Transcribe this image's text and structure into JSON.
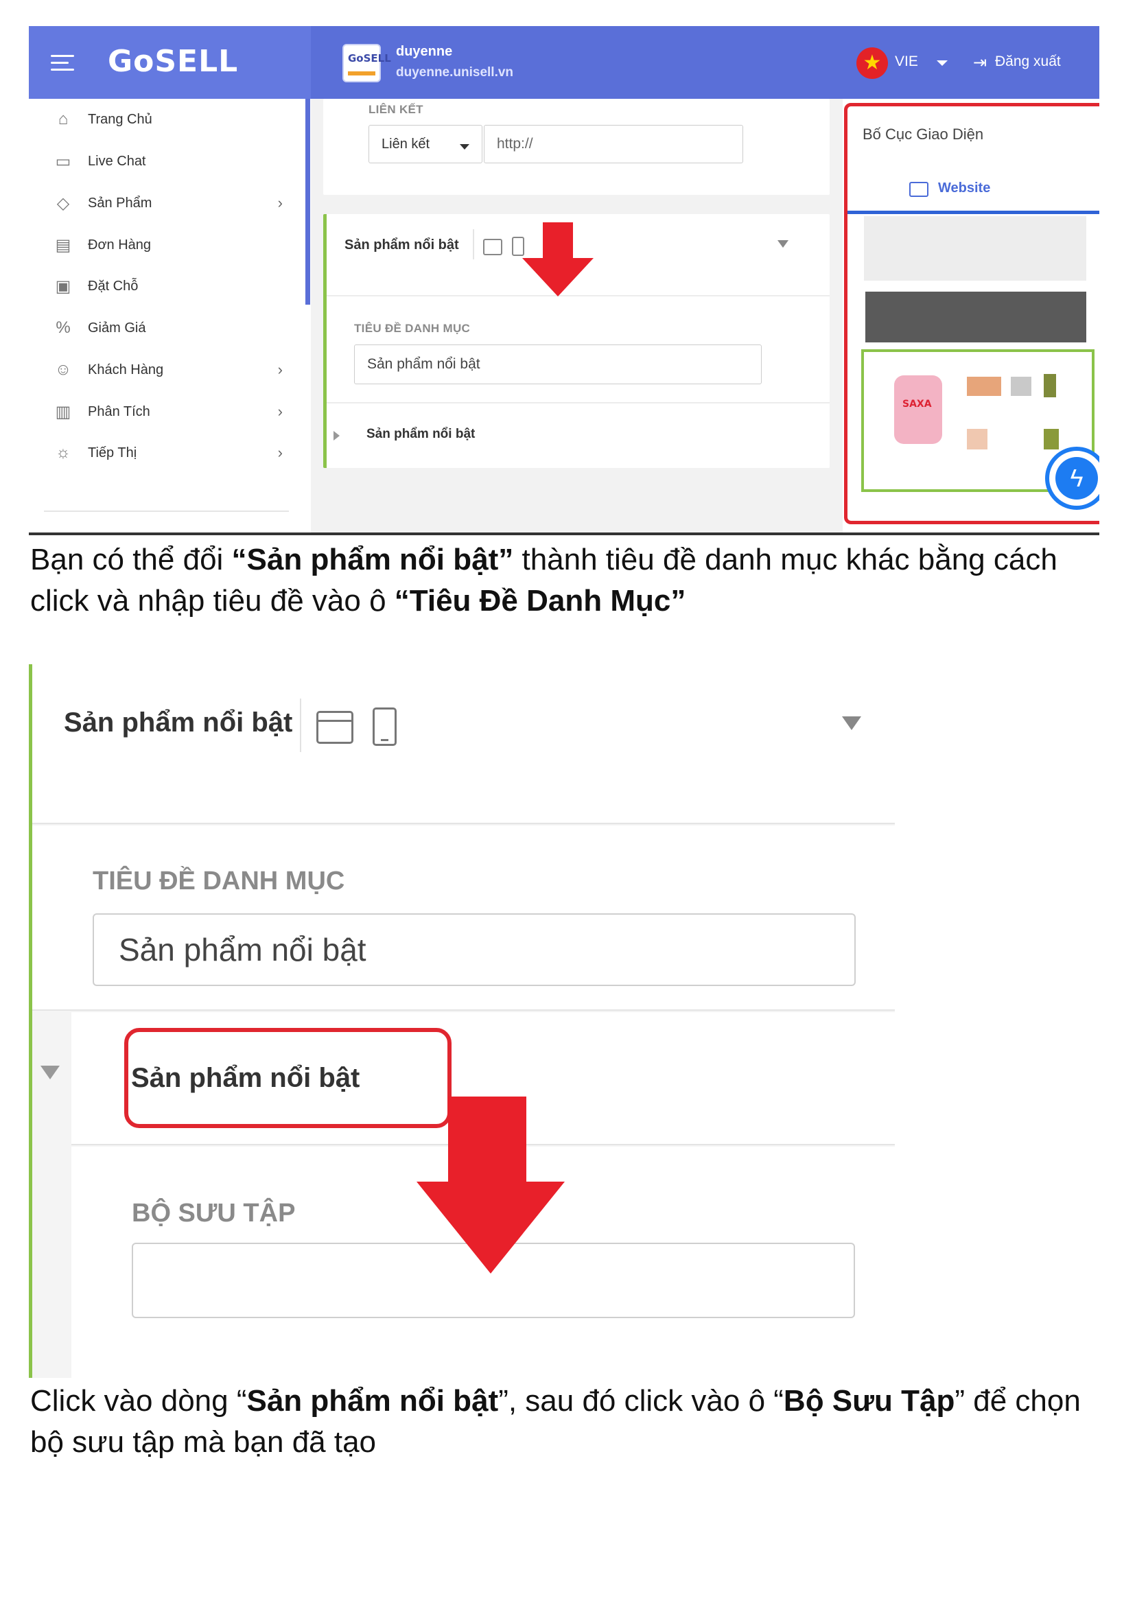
{
  "app": {
    "logo_text": "GoSELL",
    "shop_name": "duyenne",
    "shop_url": "duyenne.unisell.vn",
    "shop_logo_text": "GoSELL",
    "language": "VIE",
    "logout_label": "Đăng xuất",
    "accent_color": "#5a6fd8"
  },
  "sidebar": {
    "items": [
      {
        "label": "Trang Chủ",
        "icon": "home-icon",
        "glyph": "⌂",
        "has_submenu": false
      },
      {
        "label": "Live Chat",
        "icon": "chat-icon",
        "glyph": "▭",
        "has_submenu": false
      },
      {
        "label": "Sản Phẩm",
        "icon": "tag-icon",
        "glyph": "◇",
        "has_submenu": true
      },
      {
        "label": "Đơn Hàng",
        "icon": "receipt-icon",
        "glyph": "▤",
        "has_submenu": false
      },
      {
        "label": "Đặt Chỗ",
        "icon": "calendar-check-icon",
        "glyph": "▣",
        "has_submenu": false
      },
      {
        "label": "Giảm Giá",
        "icon": "discount-icon",
        "glyph": "%",
        "has_submenu": false
      },
      {
        "label": "Khách Hàng",
        "icon": "users-icon",
        "glyph": "☺",
        "has_submenu": true
      },
      {
        "label": "Phân Tích",
        "icon": "chart-icon",
        "glyph": "▥",
        "has_submenu": true
      },
      {
        "label": "Tiếp Thị",
        "icon": "lightbulb-icon",
        "glyph": "☼",
        "has_submenu": true
      }
    ],
    "chevron": "›"
  },
  "editor": {
    "link_section_label": "LIÊN KẾT",
    "link_type_value": "Liên kết",
    "link_url_placeholder": "http://",
    "featured_card_title": "Sản phẩm nổi bật",
    "category_title_label": "TIÊU ĐỀ DANH MỤC",
    "category_title_value": "Sản phẩm nổi bật",
    "subitem_title": "Sản phẩm nổi bật"
  },
  "preview": {
    "title": "Bố Cục Giao Diện",
    "tab_label": "Website"
  },
  "instructions": {
    "p1_before": "Bạn có thể đổi ",
    "p1_bold1": "“Sản phẩm nổi bật”",
    "p1_middle": " thành tiêu đề danh mục khác bằng cách click và nhập tiêu đề vào ô ",
    "p1_bold2": "“Tiêu Đề Danh Mục”",
    "p2_before": "Click vào dòng “",
    "p2_bold1": "Sản phẩm nổi bật",
    "p2_middle": "”, sau đó click vào ô “",
    "p2_bold2": "Bộ Sưu Tập",
    "p2_after": "” để chọn bộ sưu tập mà bạn đã tạo"
  },
  "zoomed": {
    "card_title": "Sản phẩm nổi bật",
    "category_title_label": "TIÊU ĐỀ DANH MỤC",
    "category_title_value": "Sản phẩm nổi bật",
    "subitem_title": "Sản phẩm nổi bật",
    "collection_label": "BỘ SƯU TẬP",
    "collection_value": ""
  },
  "colors": {
    "highlight_red": "#e0262f",
    "section_green": "#8bc34a",
    "arrow_red": "#e8202a"
  }
}
